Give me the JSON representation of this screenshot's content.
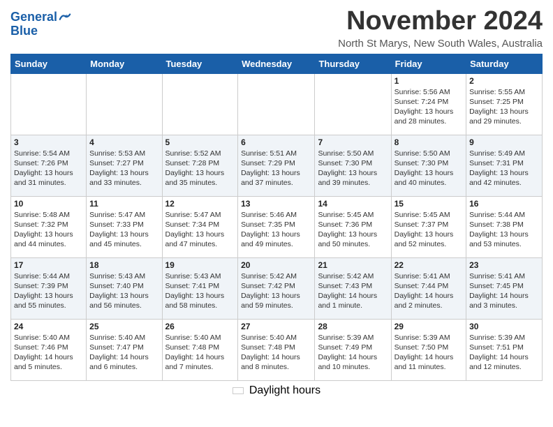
{
  "header": {
    "logo_line1": "General",
    "logo_line2": "Blue",
    "month_title": "November 2024",
    "subtitle": "North St Marys, New South Wales, Australia"
  },
  "days_of_week": [
    "Sunday",
    "Monday",
    "Tuesday",
    "Wednesday",
    "Thursday",
    "Friday",
    "Saturday"
  ],
  "weeks": [
    [
      {
        "day": "",
        "info": ""
      },
      {
        "day": "",
        "info": ""
      },
      {
        "day": "",
        "info": ""
      },
      {
        "day": "",
        "info": ""
      },
      {
        "day": "",
        "info": ""
      },
      {
        "day": "1",
        "info": "Sunrise: 5:56 AM\nSunset: 7:24 PM\nDaylight: 13 hours and 28 minutes."
      },
      {
        "day": "2",
        "info": "Sunrise: 5:55 AM\nSunset: 7:25 PM\nDaylight: 13 hours and 29 minutes."
      }
    ],
    [
      {
        "day": "3",
        "info": "Sunrise: 5:54 AM\nSunset: 7:26 PM\nDaylight: 13 hours and 31 minutes."
      },
      {
        "day": "4",
        "info": "Sunrise: 5:53 AM\nSunset: 7:27 PM\nDaylight: 13 hours and 33 minutes."
      },
      {
        "day": "5",
        "info": "Sunrise: 5:52 AM\nSunset: 7:28 PM\nDaylight: 13 hours and 35 minutes."
      },
      {
        "day": "6",
        "info": "Sunrise: 5:51 AM\nSunset: 7:29 PM\nDaylight: 13 hours and 37 minutes."
      },
      {
        "day": "7",
        "info": "Sunrise: 5:50 AM\nSunset: 7:30 PM\nDaylight: 13 hours and 39 minutes."
      },
      {
        "day": "8",
        "info": "Sunrise: 5:50 AM\nSunset: 7:30 PM\nDaylight: 13 hours and 40 minutes."
      },
      {
        "day": "9",
        "info": "Sunrise: 5:49 AM\nSunset: 7:31 PM\nDaylight: 13 hours and 42 minutes."
      }
    ],
    [
      {
        "day": "10",
        "info": "Sunrise: 5:48 AM\nSunset: 7:32 PM\nDaylight: 13 hours and 44 minutes."
      },
      {
        "day": "11",
        "info": "Sunrise: 5:47 AM\nSunset: 7:33 PM\nDaylight: 13 hours and 45 minutes."
      },
      {
        "day": "12",
        "info": "Sunrise: 5:47 AM\nSunset: 7:34 PM\nDaylight: 13 hours and 47 minutes."
      },
      {
        "day": "13",
        "info": "Sunrise: 5:46 AM\nSunset: 7:35 PM\nDaylight: 13 hours and 49 minutes."
      },
      {
        "day": "14",
        "info": "Sunrise: 5:45 AM\nSunset: 7:36 PM\nDaylight: 13 hours and 50 minutes."
      },
      {
        "day": "15",
        "info": "Sunrise: 5:45 AM\nSunset: 7:37 PM\nDaylight: 13 hours and 52 minutes."
      },
      {
        "day": "16",
        "info": "Sunrise: 5:44 AM\nSunset: 7:38 PM\nDaylight: 13 hours and 53 minutes."
      }
    ],
    [
      {
        "day": "17",
        "info": "Sunrise: 5:44 AM\nSunset: 7:39 PM\nDaylight: 13 hours and 55 minutes."
      },
      {
        "day": "18",
        "info": "Sunrise: 5:43 AM\nSunset: 7:40 PM\nDaylight: 13 hours and 56 minutes."
      },
      {
        "day": "19",
        "info": "Sunrise: 5:43 AM\nSunset: 7:41 PM\nDaylight: 13 hours and 58 minutes."
      },
      {
        "day": "20",
        "info": "Sunrise: 5:42 AM\nSunset: 7:42 PM\nDaylight: 13 hours and 59 minutes."
      },
      {
        "day": "21",
        "info": "Sunrise: 5:42 AM\nSunset: 7:43 PM\nDaylight: 14 hours and 1 minute."
      },
      {
        "day": "22",
        "info": "Sunrise: 5:41 AM\nSunset: 7:44 PM\nDaylight: 14 hours and 2 minutes."
      },
      {
        "day": "23",
        "info": "Sunrise: 5:41 AM\nSunset: 7:45 PM\nDaylight: 14 hours and 3 minutes."
      }
    ],
    [
      {
        "day": "24",
        "info": "Sunrise: 5:40 AM\nSunset: 7:46 PM\nDaylight: 14 hours and 5 minutes."
      },
      {
        "day": "25",
        "info": "Sunrise: 5:40 AM\nSunset: 7:47 PM\nDaylight: 14 hours and 6 minutes."
      },
      {
        "day": "26",
        "info": "Sunrise: 5:40 AM\nSunset: 7:48 PM\nDaylight: 14 hours and 7 minutes."
      },
      {
        "day": "27",
        "info": "Sunrise: 5:40 AM\nSunset: 7:48 PM\nDaylight: 14 hours and 8 minutes."
      },
      {
        "day": "28",
        "info": "Sunrise: 5:39 AM\nSunset: 7:49 PM\nDaylight: 14 hours and 10 minutes."
      },
      {
        "day": "29",
        "info": "Sunrise: 5:39 AM\nSunset: 7:50 PM\nDaylight: 14 hours and 11 minutes."
      },
      {
        "day": "30",
        "info": "Sunrise: 5:39 AM\nSunset: 7:51 PM\nDaylight: 14 hours and 12 minutes."
      }
    ]
  ],
  "footer": {
    "legend_label": "Daylight hours"
  }
}
